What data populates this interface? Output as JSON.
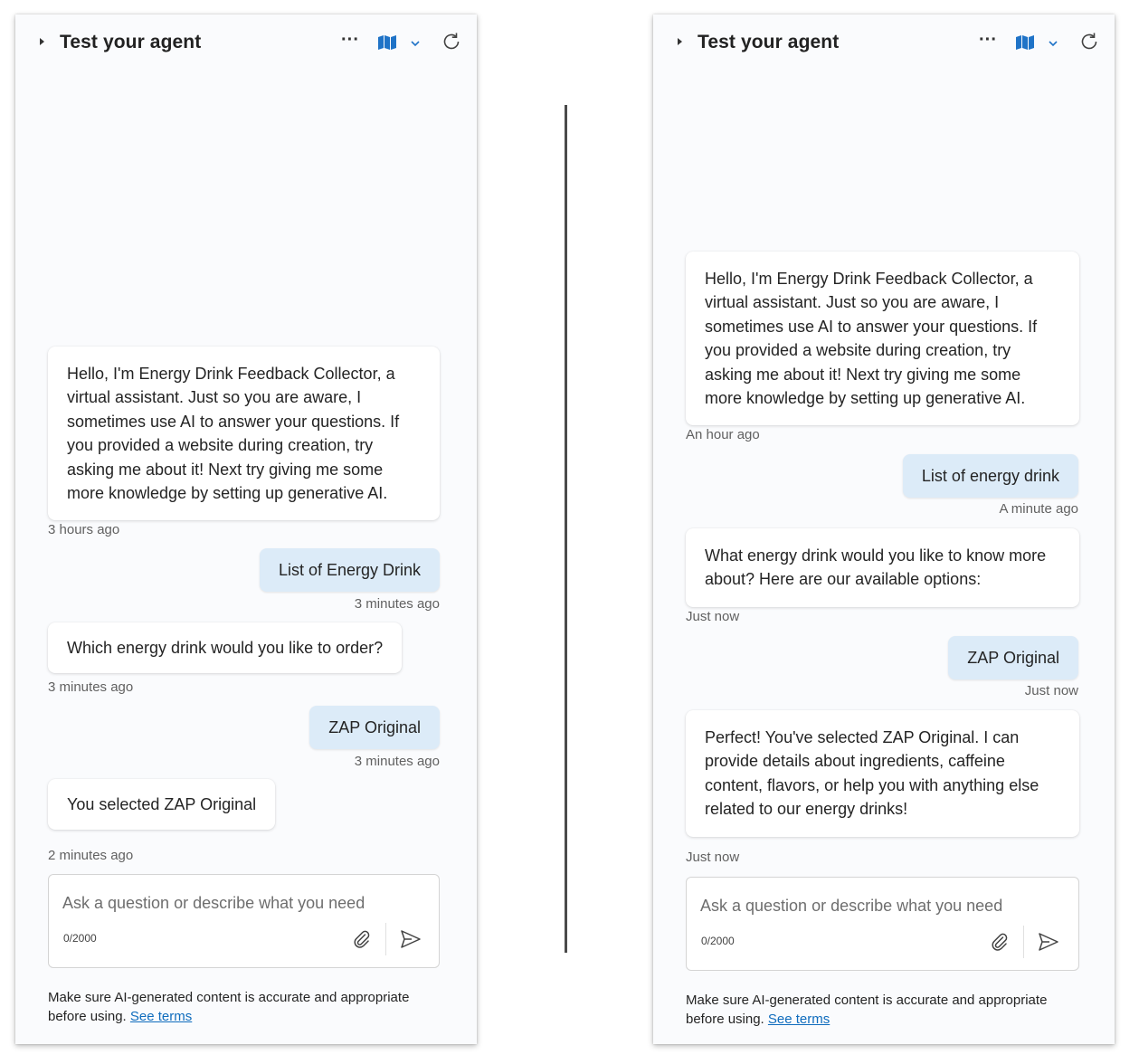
{
  "header": {
    "title": "Test your agent",
    "more_label": "···"
  },
  "left": {
    "messages": [
      {
        "role": "bot",
        "text": "Hello, I'm Energy Drink Feedback Collector, a virtual assistant. Just so you are aware, I sometimes use AI to answer your questions. If you provided a website during creation, try asking me about it! Next try giving me some more knowledge by setting up generative AI.",
        "time": "3 hours ago"
      },
      {
        "role": "user",
        "text": "List of Energy Drink",
        "time": "3 minutes ago"
      },
      {
        "role": "bot",
        "text": "Which energy drink would you like to order?",
        "time": "3 minutes ago"
      },
      {
        "role": "user",
        "text": "ZAP Original",
        "time": "3 minutes ago"
      },
      {
        "role": "bot",
        "text": "You selected ZAP Original",
        "time": "2 minutes ago"
      }
    ]
  },
  "right": {
    "messages": [
      {
        "role": "bot",
        "text": "Hello, I'm Energy Drink Feedback Collector, a virtual assistant. Just so you are aware, I sometimes use AI to answer your questions. If you provided a website during creation, try asking me about it! Next try giving me some more knowledge by setting up generative AI.",
        "time": "An hour ago"
      },
      {
        "role": "user",
        "text": "List of energy drink",
        "time": "A minute ago"
      },
      {
        "role": "bot",
        "text": "What energy drink would you like to know more about? Here are our available options:",
        "time": "Just now"
      },
      {
        "role": "user",
        "text": "ZAP Original",
        "time": "Just now"
      },
      {
        "role": "bot",
        "text": "Perfect! You've selected ZAP Original. I can provide details about ingredients, caffeine content, flavors, or help you with anything else related to our energy drinks!",
        "time": "Just now"
      }
    ]
  },
  "composer": {
    "placeholder": "Ask a question or describe what you need",
    "counter": "0/2000"
  },
  "disclaimer": {
    "text": "Make sure AI-generated content is accurate and appropriate before using.",
    "link": "See terms"
  },
  "colors": {
    "accent": "#0f6cbd",
    "user_bubble": "#dcebf8",
    "panel_bg": "#fafbfd"
  },
  "icons": [
    "caret-right-icon",
    "more-icon",
    "map-icon",
    "chevron-down-icon",
    "refresh-icon",
    "attach-icon",
    "send-icon"
  ]
}
